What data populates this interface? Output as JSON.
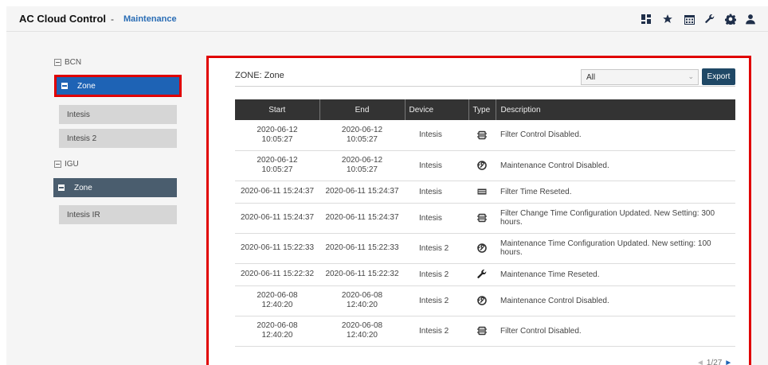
{
  "header": {
    "app_title": "AC Cloud Control",
    "separator": "-",
    "page": "Maintenance",
    "icons": [
      "dashboard-icon",
      "star-icon",
      "calendar-icon",
      "wrench-icon",
      "gear-icon",
      "user-icon"
    ]
  },
  "sidebar": {
    "groups": [
      {
        "label": "BCN",
        "zone": "Zone",
        "devices": [
          "Intesis",
          "Intesis 2"
        ]
      },
      {
        "label": "IGU",
        "zone": "Zone",
        "devices": [
          "Intesis IR"
        ]
      }
    ]
  },
  "panel": {
    "zone_title": "ZONE: Zone",
    "filter_value": "All",
    "export_label": "Export",
    "columns": [
      "Start",
      "End",
      "Device",
      "Type",
      "Description"
    ],
    "rows": [
      {
        "start": "2020-06-12\n10:05:27",
        "end": "2020-06-12\n10:05:27",
        "device": "Intesis",
        "type": "filter-icon",
        "description": "Filter Control Disabled."
      },
      {
        "start": "2020-06-12\n10:05:27",
        "end": "2020-06-12\n10:05:27",
        "device": "Intesis",
        "type": "maintenance-icon",
        "description": "Maintenance Control Disabled."
      },
      {
        "start": "2020-06-11 15:24:37",
        "end": "2020-06-11 15:24:37",
        "device": "Intesis",
        "type": "filter-reset-icon",
        "description": "Filter Time Reseted."
      },
      {
        "start": "2020-06-11 15:24:37",
        "end": "2020-06-11 15:24:37",
        "device": "Intesis",
        "type": "filter-icon",
        "description": "Filter Change Time Configuration Updated. New Setting: 300 hours."
      },
      {
        "start": "2020-06-11 15:22:33",
        "end": "2020-06-11 15:22:33",
        "device": "Intesis 2",
        "type": "maintenance-icon",
        "description": "Maintenance Time Configuration Updated. New setting: 100 hours."
      },
      {
        "start": "2020-06-11 15:22:32",
        "end": "2020-06-11 15:22:32",
        "device": "Intesis 2",
        "type": "wrench-icon",
        "description": "Maintenance Time Reseted."
      },
      {
        "start": "2020-06-08\n12:40:20",
        "end": "2020-06-08\n12:40:20",
        "device": "Intesis 2",
        "type": "maintenance-icon",
        "description": "Maintenance Control Disabled."
      },
      {
        "start": "2020-06-08\n12:40:20",
        "end": "2020-06-08\n12:40:20",
        "device": "Intesis 2",
        "type": "filter-icon",
        "description": "Filter Control Disabled."
      }
    ],
    "pager": {
      "prev": "◄",
      "page": "1/27",
      "next": "►"
    }
  },
  "colors": {
    "accent_blue": "#1e63b5",
    "zone_dark": "#4a5d6e",
    "highlight_red": "#e00000",
    "table_header": "#333333",
    "export_button": "#1f4866"
  }
}
